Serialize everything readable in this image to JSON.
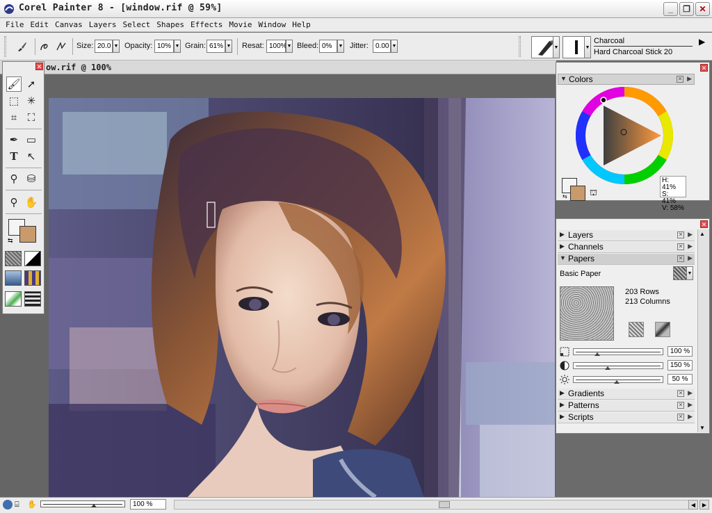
{
  "window": {
    "title": "Corel Painter 8 - [window.rif @ 59%]"
  },
  "window_buttons": {
    "minimize": "_",
    "restore": "❐",
    "close": "✕"
  },
  "menu": [
    "File",
    "Edit",
    "Canvas",
    "Layers",
    "Select",
    "Shapes",
    "Effects",
    "Movie",
    "Window",
    "Help"
  ],
  "property_bar": {
    "size_label": "Size:",
    "size_value": "20.0",
    "opacity_label": "Opacity:",
    "opacity_value": "10%",
    "grain_label": "Grain:",
    "grain_value": "61%",
    "resat_label": "Resat:",
    "resat_value": "100%",
    "bleed_label": "Bleed:",
    "bleed_value": "0%",
    "jitter_label": "Jitter:",
    "jitter_value": "0.00"
  },
  "brush": {
    "category": "Charcoal",
    "variant": "Hard Charcoal Stick 20"
  },
  "document": {
    "title": "ow.rif @ 100%"
  },
  "toolbox": {
    "tools": [
      "brush-icon",
      "layer-adjuster-icon",
      "rect-select-icon",
      "magic-wand-icon",
      "crop-icon",
      "lasso-icon",
      "pen-icon",
      "rectangle-shape-icon",
      "text-icon",
      "shape-selection-icon",
      "dropper-icon",
      "paint-bucket-icon",
      "magnifier-icon",
      "grabber-hand-icon"
    ],
    "main_color": "#f4f4f4",
    "additional_color": "#c89a6c"
  },
  "colors_panel": {
    "title": "Colors",
    "h": "H: 41%",
    "s": "S: 41%",
    "v": "V: 58%"
  },
  "stack_panels": {
    "layers": "Layers",
    "channels": "Channels",
    "papers": "Papers",
    "gradients": "Gradients",
    "patterns": "Patterns",
    "scripts": "Scripts"
  },
  "papers": {
    "name": "Basic Paper",
    "rows": "203 Rows",
    "columns": "213 Columns",
    "scale_value": "100 %",
    "contrast_value": "150 %",
    "brightness_value": "50 %",
    "scale_level": 0.25,
    "contrast_level": 0.38,
    "brightness_level": 0.48
  },
  "status": {
    "zoom": "100 %"
  }
}
